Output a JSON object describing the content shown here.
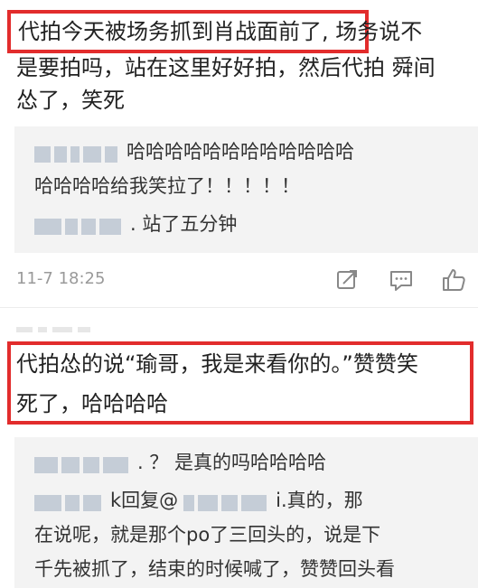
{
  "comment1": {
    "highlighted_text": "代拍今天被场务抓到肖战面前了,",
    "line1_rest": " 场务说不",
    "line2": "是要拍吗，站在这里好好拍，然后代拍 舜间",
    "line3": "怂了，笑死",
    "replies": [
      {
        "line1": "哈哈哈哈哈哈哈哈哈哈哈哈",
        "line2": "哈哈哈哈给我笑拉了！！！！！"
      },
      {
        "text": ". 站了五分钟"
      }
    ],
    "timestamp": "11-7 18:25"
  },
  "comment2": {
    "line1": "代拍怂的说“瑜哥，我是来看你的。”赞赞笑",
    "line2": "死了，哈哈哈哈",
    "replies": [
      {
        "text": ". ？ 是真的吗哈哈哈哈"
      },
      {
        "line1": "k回复@",
        "line1_b": "ⅰ.真的，那",
        "line2": "在说呢，就是那个po了三回头的，说是下",
        "line3": "千先被抓了，结束的时候喊了，赞赞回头看"
      }
    ]
  },
  "icons": [
    "share-icon",
    "comment-icon",
    "like-icon"
  ],
  "colors": {
    "highlight": "#e22c2c",
    "reply_bg": "#f3f3f3",
    "text": "#222222",
    "meta": "#9a9a9a"
  }
}
